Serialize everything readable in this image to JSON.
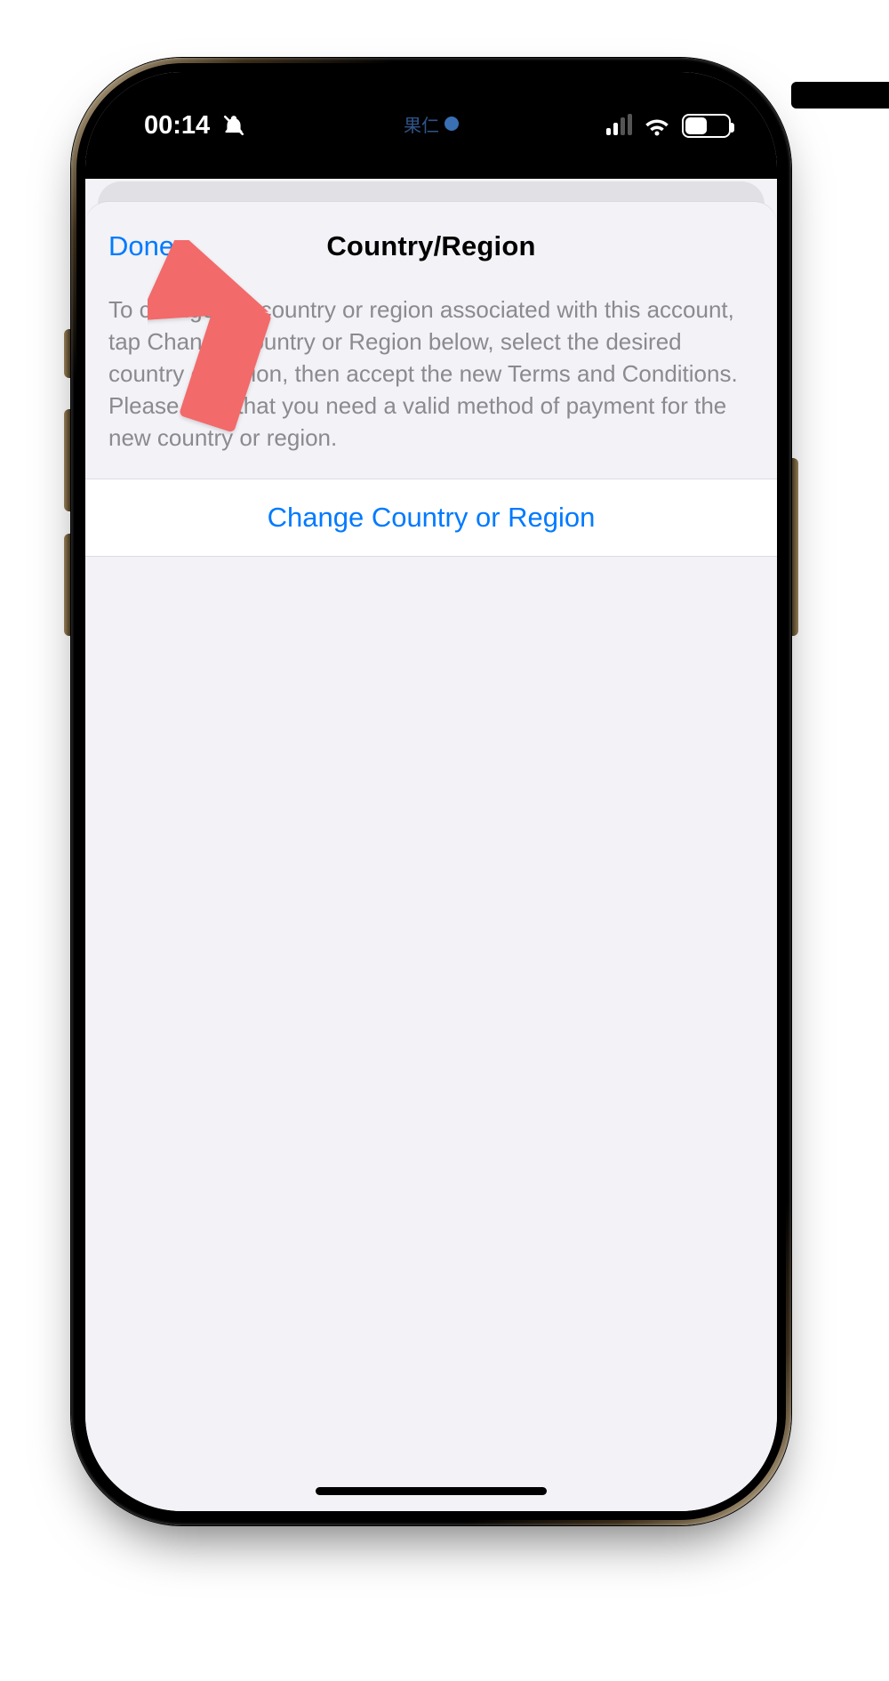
{
  "status": {
    "time": "00:14",
    "battery_pct": "48",
    "island_text": "果仁"
  },
  "sheet": {
    "nav": {
      "done_label": "Done",
      "title": "Country/Region"
    },
    "description": "To change the country or region associated with this account, tap Change Country or Region below, select the desired country or region, then accept the new Terms and Conditions. Please note that you need a valid method of payment for the new country or region.",
    "action_label": "Change Country or Region"
  },
  "annotation": {
    "arrow_color": "#f26b6b"
  }
}
